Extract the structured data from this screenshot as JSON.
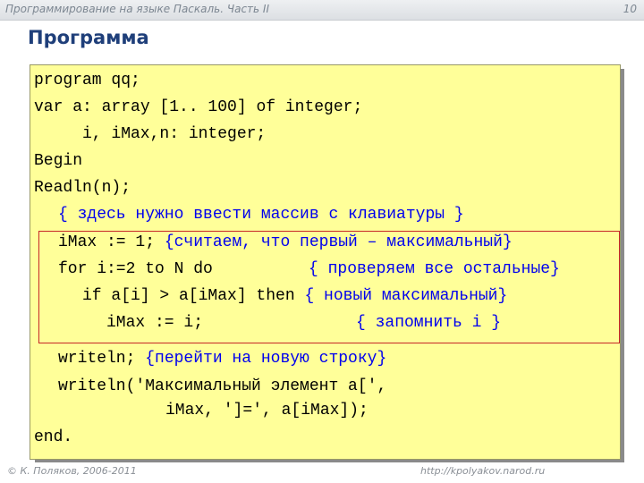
{
  "header": {
    "text": "Программирование на языке Паскаль. Часть II",
    "page_number": "10"
  },
  "slide": {
    "title": "Программа"
  },
  "code": {
    "line1": "program qq;",
    "line2": "var a: array [1.. 100] of integer;",
    "line3": "i, iMax,n: integer;",
    "line4": "Begin",
    "line5": "Readln(n);",
    "line6_comment": "{ здесь нужно ввести массив с клавиатуры }",
    "line7_code": "iMax := 1; ",
    "line7_comment": "{считаем, что первый – максимальный}",
    "line8_code": "for i:=2 to N do",
    "line8_comment": "{ проверяем все остальные}",
    "line9_code": "if a[i] > a[iMax] then ",
    "line9_comment": "{ новый максимальный}",
    "line10_code": "iMax := i;",
    "line10_comment": "{ запомнить i }",
    "line11_code": "writeln; ",
    "line11_comment": "{перейти на новую строку}",
    "line12": "writeln('Максимальный элемент a[',",
    "line13": "iMax, ']=', a[iMax]);",
    "line14": "end."
  },
  "footer": {
    "copyright": "© К. Поляков, 2006-2011",
    "url": "http://kpolyakov.narod.ru"
  }
}
